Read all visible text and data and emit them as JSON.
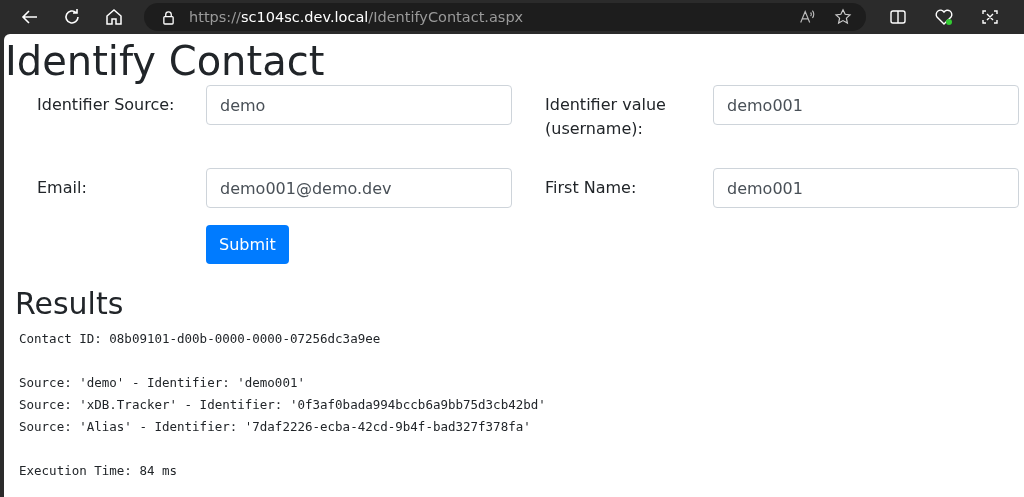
{
  "browser": {
    "url": [
      {
        "text": "https://",
        "kind": "dim"
      },
      {
        "text": "sc104sc.dev.local",
        "kind": "host"
      },
      {
        "text": "/IdentifyContact.aspx",
        "kind": "dim"
      }
    ]
  },
  "page_title": "Identify Contact",
  "form": {
    "fields": [
      {
        "label": "Identifier Source:",
        "value": "demo"
      },
      {
        "label": "Identifier value (username):",
        "value": "demo001"
      },
      {
        "label": "Email:",
        "value": "demo001@demo.dev"
      },
      {
        "label": "First Name:",
        "value": "demo001"
      }
    ],
    "submit": "Submit"
  },
  "results": {
    "title": "Results",
    "groups": [
      [
        "Contact ID: 08b09101-d00b-0000-0000-07256dc3a9ee"
      ],
      [
        "Source: 'demo' - Identifier: 'demo001'",
        "Source: 'xDB.Tracker' - Identifier: '0f3af0bada994bccb6a9bb75d3cb42bd'",
        "Source: 'Alias' - Identifier: '7daf2226-ecba-42cd-9b4f-bad327f378fa'"
      ],
      [
        "Execution Time: 84 ms"
      ]
    ]
  }
}
